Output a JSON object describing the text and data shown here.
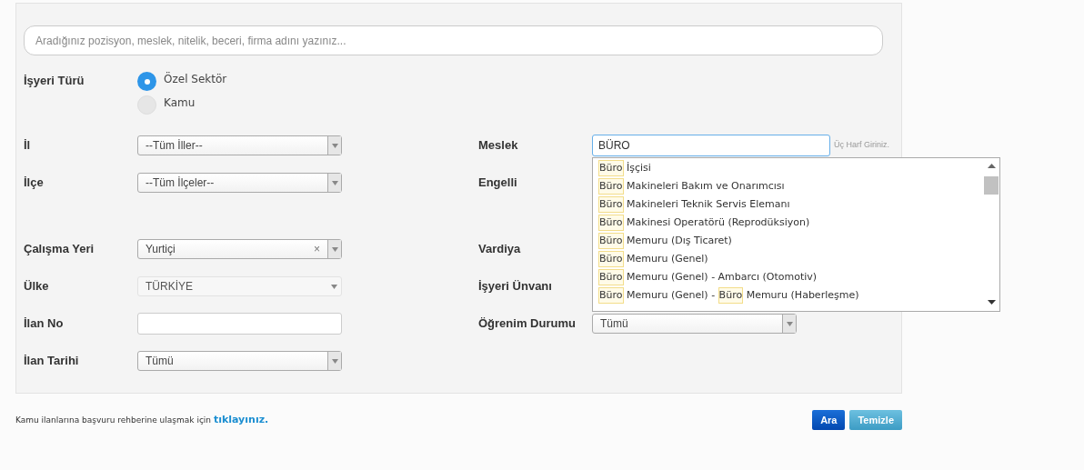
{
  "search": {
    "placeholder": "Aradığınız pozisyon, meslek, nitelik, beceri, firma adını yazınız..."
  },
  "workplace_type": {
    "label": "İşyeri Türü",
    "options": [
      {
        "label": "Özel Sektör",
        "selected": true
      },
      {
        "label": "Kamu",
        "selected": false
      }
    ]
  },
  "left_fields": [
    {
      "label": "İl",
      "kind": "select",
      "value": "--Tüm İller--",
      "disabled": false
    },
    {
      "label": "İlçe",
      "kind": "select",
      "value": "--Tüm İlçeler--",
      "disabled": false
    },
    {
      "label": "Çalışma Yeri",
      "kind": "select",
      "value": "Yurtiçi",
      "clear_symbol": "×",
      "disabled": false
    },
    {
      "label": "Ülke",
      "kind": "select",
      "value": "TÜRKİYE",
      "disabled": true
    },
    {
      "label": "İlan No",
      "kind": "text"
    },
    {
      "label": "İlan Tarihi",
      "kind": "select",
      "value": "Tümü",
      "disabled": false
    }
  ],
  "right_fields": [
    {
      "label": "Meslek",
      "kind": "autocomplete",
      "value": "BÜRO",
      "hint": "Üç Harf Giriniz."
    },
    {
      "label": "Engelli",
      "kind": "covered"
    },
    {
      "label": "Vardiya",
      "kind": "covered"
    },
    {
      "label": "İşyeri Ünvanı",
      "kind": "covered"
    },
    {
      "label": "Öğrenim Durumu",
      "kind": "select",
      "value": "Tümü",
      "disabled": false
    }
  ],
  "occupation_suggestions": [
    {
      "parts": [
        {
          "text": "Büro",
          "highlighted": true
        },
        {
          "text": " İşçisi",
          "highlighted": false
        }
      ]
    },
    {
      "parts": [
        {
          "text": "Büro",
          "highlighted": true
        },
        {
          "text": " Makineleri Bakım ve Onarımcısı",
          "highlighted": false
        }
      ]
    },
    {
      "parts": [
        {
          "text": "Büro",
          "highlighted": true
        },
        {
          "text": " Makineleri Teknik Servis Elemanı",
          "highlighted": false
        }
      ]
    },
    {
      "parts": [
        {
          "text": "Büro",
          "highlighted": true
        },
        {
          "text": " Makinesi Operatörü (Reprodüksiyon)",
          "highlighted": false
        }
      ]
    },
    {
      "parts": [
        {
          "text": "Büro",
          "highlighted": true
        },
        {
          "text": " Memuru (Dış Ticaret)",
          "highlighted": false
        }
      ]
    },
    {
      "parts": [
        {
          "text": "Büro",
          "highlighted": true
        },
        {
          "text": " Memuru (Genel)",
          "highlighted": false
        }
      ]
    },
    {
      "parts": [
        {
          "text": "Büro",
          "highlighted": true
        },
        {
          "text": " Memuru (Genel) - Ambarcı (Otomotiv)",
          "highlighted": false
        }
      ]
    },
    {
      "parts": [
        {
          "text": "Büro",
          "highlighted": true
        },
        {
          "text": " Memuru (Genel) - ",
          "highlighted": false
        },
        {
          "text": "Büro",
          "highlighted": true
        },
        {
          "text": " Memuru (Haberleşme)",
          "highlighted": false
        }
      ]
    }
  ],
  "footer": {
    "text": "Kamu ilanlarına başvuru rehberine ulaşmak için",
    "link": "tıklayınız."
  },
  "buttons": [
    {
      "label": "Ara",
      "kind": "primary"
    },
    {
      "label": "Temizle",
      "kind": "secondary"
    }
  ]
}
